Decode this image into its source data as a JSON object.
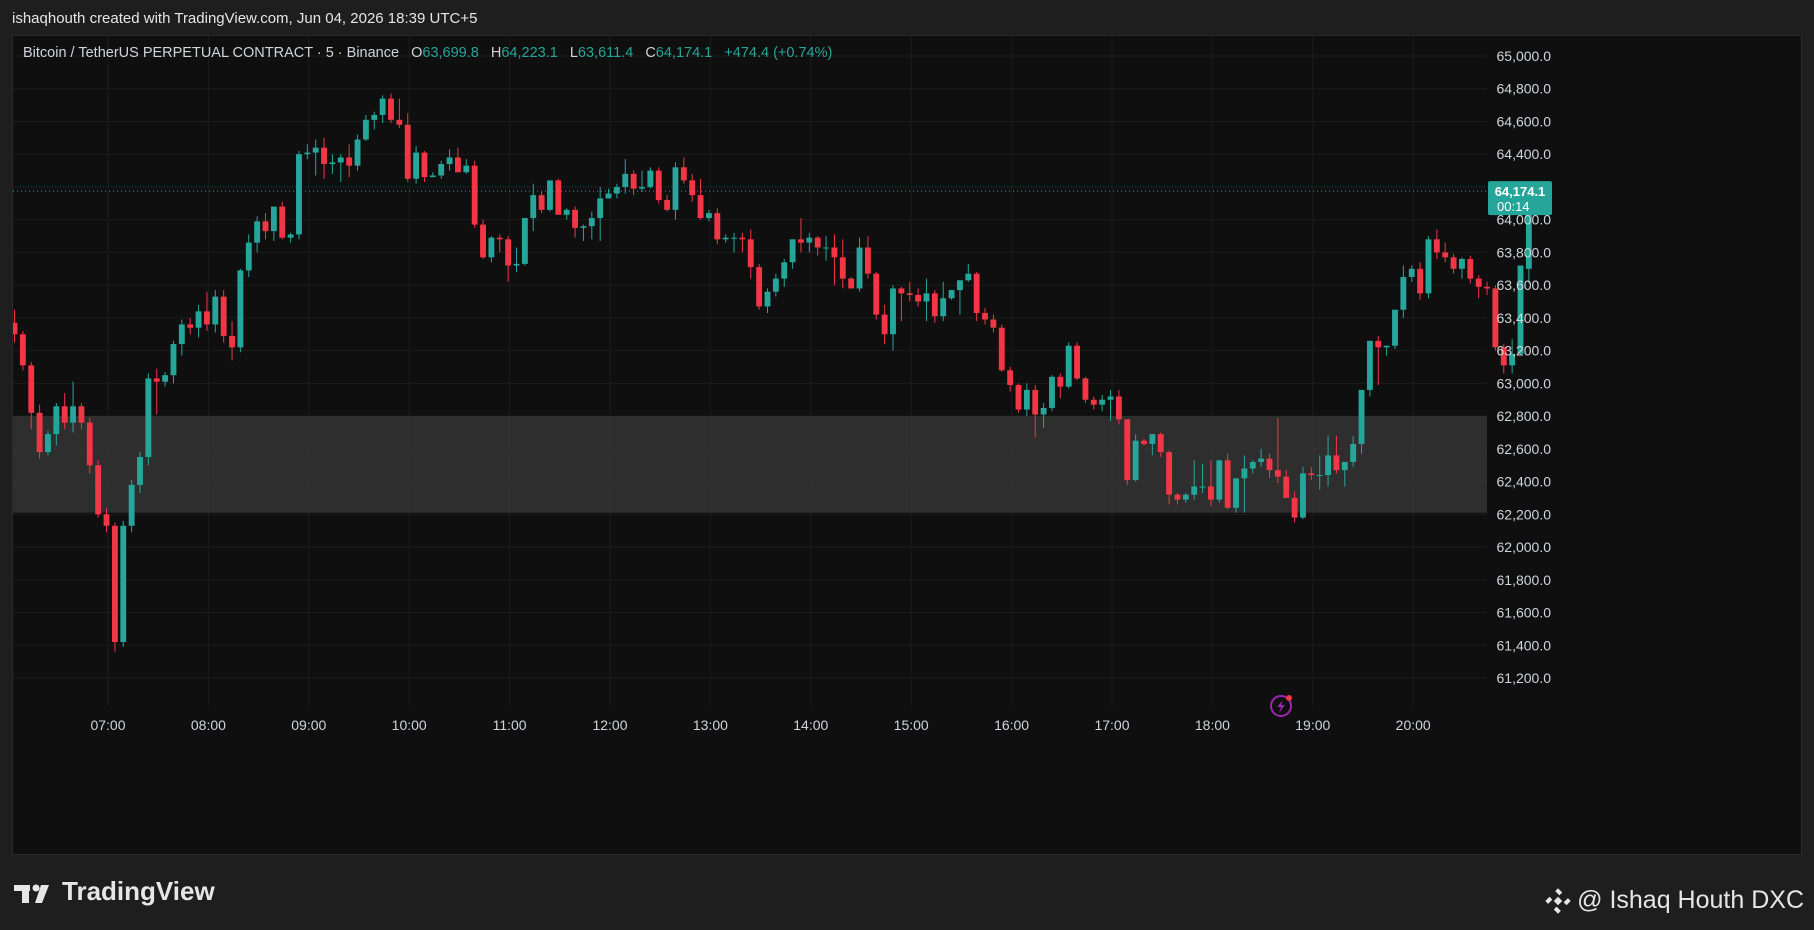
{
  "header": {
    "caption": "ishaqhouth created with TradingView.com, Jun 04, 2026 18:39 UTC+5"
  },
  "legend": {
    "symbol": "Bitcoin / TetherUS PERPETUAL CONTRACT · 5 · Binance",
    "o_label": "O",
    "o_value": "63,699.8",
    "h_label": "H",
    "h_value": "64,223.1",
    "l_label": "L",
    "l_value": "63,611.4",
    "c_label": "C",
    "c_value": "64,174.1",
    "change": "+474.4 (+0.74%)"
  },
  "price_badge": {
    "price": "64,174.1",
    "countdown": "00:14"
  },
  "footer": {
    "logo_text": "TradingView",
    "credit": "@ Ishaq Houth DXC"
  },
  "colors": {
    "up": "#26a69a",
    "down": "#f23645",
    "zone": "#3a3a3a",
    "bg": "#0f0f0f"
  },
  "chart_data": {
    "type": "candlestick",
    "interval_minutes": 5,
    "x_ticks": [
      "07:00",
      "08:00",
      "09:00",
      "10:00",
      "11:00",
      "12:00",
      "13:00",
      "14:00",
      "15:00",
      "16:00",
      "17:00",
      "18:00",
      "19:00",
      "20:00"
    ],
    "y_ticks": [
      "65,000.0",
      "64,800.0",
      "64,600.0",
      "64,400.0",
      "64,200.0",
      "64,000.0",
      "63,800.0",
      "63,600.0",
      "63,400.0",
      "63,200.0",
      "63,000.0",
      "62,800.0",
      "62,600.0",
      "62,400.0",
      "62,200.0",
      "62,000.0",
      "61,800.0",
      "61,600.0",
      "61,400.0",
      "61,200.0"
    ],
    "ylim": [
      61100,
      65100
    ],
    "last_price": 64174.1,
    "zone": {
      "from": 62210,
      "to": 62800
    },
    "candles": [
      [
        63370,
        63450,
        63250,
        63300
      ],
      [
        63300,
        63320,
        63080,
        63110
      ],
      [
        63110,
        63130,
        62720,
        62820
      ],
      [
        62820,
        62870,
        62540,
        62580
      ],
      [
        62580,
        62710,
        62560,
        62690
      ],
      [
        62690,
        62880,
        62620,
        62860
      ],
      [
        62860,
        62940,
        62720,
        62760
      ],
      [
        62760,
        63010,
        62700,
        62860
      ],
      [
        62860,
        62880,
        62720,
        62760
      ],
      [
        62760,
        62790,
        62450,
        62500
      ],
      [
        62500,
        62530,
        62180,
        62200
      ],
      [
        62200,
        62240,
        62090,
        62130
      ],
      [
        62130,
        62150,
        61360,
        61420
      ],
      [
        61420,
        62160,
        61390,
        62130
      ],
      [
        62130,
        62410,
        62090,
        62380
      ],
      [
        62380,
        62580,
        62330,
        62550
      ],
      [
        62550,
        63060,
        62500,
        63030
      ],
      [
        63030,
        63090,
        62810,
        63010
      ],
      [
        63010,
        63070,
        62980,
        63050
      ],
      [
        63050,
        63260,
        63000,
        63240
      ],
      [
        63240,
        63390,
        63170,
        63360
      ],
      [
        63360,
        63400,
        63300,
        63340
      ],
      [
        63340,
        63480,
        63280,
        63440
      ],
      [
        63440,
        63560,
        63320,
        63360
      ],
      [
        63360,
        63570,
        63310,
        63530
      ],
      [
        63530,
        63570,
        63250,
        63290
      ],
      [
        63290,
        63380,
        63140,
        63220
      ],
      [
        63220,
        63700,
        63190,
        63690
      ],
      [
        63690,
        63910,
        63650,
        63860
      ],
      [
        63860,
        64020,
        63800,
        63990
      ],
      [
        63990,
        64040,
        63880,
        63930
      ],
      [
        63930,
        64060,
        63870,
        64080
      ],
      [
        64080,
        64110,
        63880,
        63890
      ],
      [
        63890,
        63920,
        63860,
        63910
      ],
      [
        63910,
        64420,
        63880,
        64400
      ],
      [
        64400,
        64460,
        64370,
        64410
      ],
      [
        64410,
        64490,
        64270,
        64440
      ],
      [
        64440,
        64500,
        64250,
        64340
      ],
      [
        64340,
        64400,
        64280,
        64350
      ],
      [
        64350,
        64400,
        64230,
        64380
      ],
      [
        64380,
        64460,
        64260,
        64330
      ],
      [
        64330,
        64520,
        64300,
        64490
      ],
      [
        64490,
        64640,
        64480,
        64610
      ],
      [
        64610,
        64660,
        64550,
        64640
      ],
      [
        64640,
        64760,
        64590,
        64740
      ],
      [
        64740,
        64770,
        64590,
        64610
      ],
      [
        64610,
        64740,
        64560,
        64580
      ],
      [
        64580,
        64650,
        64230,
        64250
      ],
      [
        64250,
        64450,
        64220,
        64410
      ],
      [
        64410,
        64420,
        64230,
        64260
      ],
      [
        64260,
        64290,
        64260,
        64270
      ],
      [
        64270,
        64360,
        64250,
        64340
      ],
      [
        64340,
        64430,
        64300,
        64380
      ],
      [
        64380,
        64440,
        64290,
        64290
      ],
      [
        64290,
        64370,
        64280,
        64330
      ],
      [
        64330,
        64360,
        63950,
        63970
      ],
      [
        63970,
        64000,
        63760,
        63770
      ],
      [
        63770,
        63900,
        63740,
        63890
      ],
      [
        63890,
        63910,
        63800,
        63880
      ],
      [
        63880,
        63900,
        63620,
        63720
      ],
      [
        63720,
        63830,
        63680,
        63730
      ],
      [
        63730,
        64010,
        63720,
        64010
      ],
      [
        64010,
        64220,
        63930,
        64150
      ],
      [
        64150,
        64170,
        64040,
        64060
      ],
      [
        64060,
        64240,
        64050,
        64240
      ],
      [
        64240,
        64250,
        64030,
        64030
      ],
      [
        64030,
        64070,
        64000,
        64060
      ],
      [
        64060,
        64080,
        63890,
        63950
      ],
      [
        63950,
        63970,
        63870,
        63960
      ],
      [
        63960,
        64050,
        63880,
        64010
      ],
      [
        64010,
        64200,
        63870,
        64130
      ],
      [
        64130,
        64190,
        64150,
        64160
      ],
      [
        64160,
        64220,
        64130,
        64200
      ],
      [
        64200,
        64370,
        64160,
        64280
      ],
      [
        64280,
        64300,
        64150,
        64190
      ],
      [
        64190,
        64300,
        64170,
        64200
      ],
      [
        64200,
        64320,
        64190,
        64300
      ],
      [
        64300,
        64320,
        64100,
        64120
      ],
      [
        64120,
        64150,
        64050,
        64060
      ],
      [
        64060,
        64350,
        64000,
        64320
      ],
      [
        64320,
        64380,
        64220,
        64240
      ],
      [
        64240,
        64280,
        64110,
        64150
      ],
      [
        64150,
        64250,
        64000,
        64010
      ],
      [
        64010,
        64060,
        63990,
        64040
      ],
      [
        64040,
        64070,
        63850,
        63880
      ],
      [
        63880,
        63910,
        63860,
        63890
      ],
      [
        63890,
        63920,
        63800,
        63890
      ],
      [
        63890,
        63920,
        63800,
        63880
      ],
      [
        63880,
        63940,
        63640,
        63710
      ],
      [
        63710,
        63730,
        63450,
        63470
      ],
      [
        63470,
        63580,
        63430,
        63560
      ],
      [
        63560,
        63670,
        63530,
        63640
      ],
      [
        63640,
        63760,
        63590,
        63740
      ],
      [
        63740,
        63880,
        63700,
        63880
      ],
      [
        63880,
        64010,
        63800,
        63860
      ],
      [
        63860,
        63920,
        63800,
        63890
      ],
      [
        63890,
        63900,
        63780,
        63830
      ],
      [
        63830,
        63900,
        63750,
        63830
      ],
      [
        63830,
        63910,
        63600,
        63770
      ],
      [
        63770,
        63880,
        63580,
        63640
      ],
      [
        63640,
        63650,
        63580,
        63580
      ],
      [
        63580,
        63890,
        63560,
        63830
      ],
      [
        63830,
        63900,
        63640,
        63670
      ],
      [
        63670,
        63680,
        63390,
        63420
      ],
      [
        63420,
        63480,
        63240,
        63300
      ],
      [
        63300,
        63600,
        63200,
        63580
      ],
      [
        63580,
        63590,
        63380,
        63550
      ],
      [
        63550,
        63620,
        63500,
        63540
      ],
      [
        63540,
        63580,
        63470,
        63500
      ],
      [
        63500,
        63640,
        63380,
        63550
      ],
      [
        63550,
        63570,
        63370,
        63410
      ],
      [
        63410,
        63620,
        63380,
        63520
      ],
      [
        63520,
        63570,
        63510,
        63570
      ],
      [
        63570,
        63620,
        63420,
        63630
      ],
      [
        63630,
        63730,
        63620,
        63670
      ],
      [
        63670,
        63680,
        63380,
        63430
      ],
      [
        63430,
        63460,
        63360,
        63390
      ],
      [
        63390,
        63420,
        63310,
        63340
      ],
      [
        63340,
        63360,
        63070,
        63080
      ],
      [
        63080,
        63100,
        62950,
        62990
      ],
      [
        62990,
        63000,
        62820,
        62840
      ],
      [
        62840,
        63000,
        62800,
        62960
      ],
      [
        62960,
        62990,
        62670,
        62810
      ],
      [
        62810,
        62880,
        62730,
        62850
      ],
      [
        62850,
        63050,
        62830,
        63040
      ],
      [
        63040,
        63060,
        62910,
        62980
      ],
      [
        62980,
        63250,
        62970,
        63230
      ],
      [
        63230,
        63250,
        63020,
        63030
      ],
      [
        63030,
        63040,
        62880,
        62900
      ],
      [
        62900,
        62920,
        62840,
        62870
      ],
      [
        62870,
        62930,
        62830,
        62900
      ],
      [
        62900,
        62960,
        62770,
        62920
      ],
      [
        62920,
        62960,
        62750,
        62780
      ],
      [
        62780,
        62780,
        62380,
        62410
      ],
      [
        62410,
        62690,
        62400,
        62650
      ],
      [
        62650,
        62660,
        62620,
        62630
      ],
      [
        62630,
        62690,
        62560,
        62690
      ],
      [
        62690,
        62700,
        62550,
        62580
      ],
      [
        62580,
        62590,
        62260,
        62320
      ],
      [
        62320,
        62330,
        62260,
        62290
      ],
      [
        62290,
        62330,
        62270,
        62320
      ],
      [
        62320,
        62530,
        62290,
        62370
      ],
      [
        62370,
        62510,
        62330,
        62370
      ],
      [
        62370,
        62530,
        62250,
        62290
      ],
      [
        62290,
        62530,
        62270,
        62530
      ],
      [
        62530,
        62570,
        62230,
        62240
      ],
      [
        62240,
        62420,
        62210,
        62420
      ],
      [
        62420,
        62560,
        62210,
        62480
      ],
      [
        62480,
        62530,
        62450,
        62520
      ],
      [
        62520,
        62600,
        62490,
        62540
      ],
      [
        62540,
        62570,
        62420,
        62470
      ],
      [
        62470,
        62790,
        62390,
        62430
      ],
      [
        62430,
        62470,
        62320,
        62300
      ],
      [
        62300,
        62340,
        62150,
        62180
      ],
      [
        62180,
        62490,
        62170,
        62450
      ],
      [
        62450,
        62490,
        62410,
        62440
      ],
      [
        62440,
        62560,
        62350,
        62440
      ],
      [
        62440,
        62680,
        62370,
        62560
      ],
      [
        62560,
        62680,
        62450,
        62470
      ],
      [
        62470,
        62510,
        62370,
        62520
      ],
      [
        62520,
        62680,
        62490,
        62630
      ],
      [
        62630,
        62730,
        62570,
        62960
      ],
      [
        62960,
        63260,
        62920,
        63260
      ],
      [
        63260,
        63290,
        62990,
        63220
      ],
      [
        63220,
        63230,
        63170,
        63230
      ],
      [
        63230,
        63430,
        63210,
        63450
      ],
      [
        63450,
        63720,
        63400,
        63650
      ],
      [
        63650,
        63720,
        63620,
        63700
      ],
      [
        63700,
        63740,
        63510,
        63550
      ],
      [
        63550,
        63900,
        63520,
        63880
      ],
      [
        63880,
        63940,
        63760,
        63800
      ],
      [
        63800,
        63860,
        63740,
        63770
      ],
      [
        63770,
        63790,
        63670,
        63700
      ],
      [
        63700,
        63770,
        63640,
        63760
      ],
      [
        63760,
        63780,
        63610,
        63640
      ],
      [
        63640,
        63660,
        63520,
        63590
      ],
      [
        63590,
        63620,
        63540,
        63580
      ],
      [
        63580,
        63600,
        63200,
        63220
      ],
      [
        63220,
        63240,
        63060,
        63110
      ],
      [
        63110,
        63270,
        63060,
        63180
      ],
      [
        63180,
        63720,
        63170,
        63720
      ],
      [
        63699.8,
        64223.1,
        63611.4,
        64174.1
      ]
    ]
  }
}
